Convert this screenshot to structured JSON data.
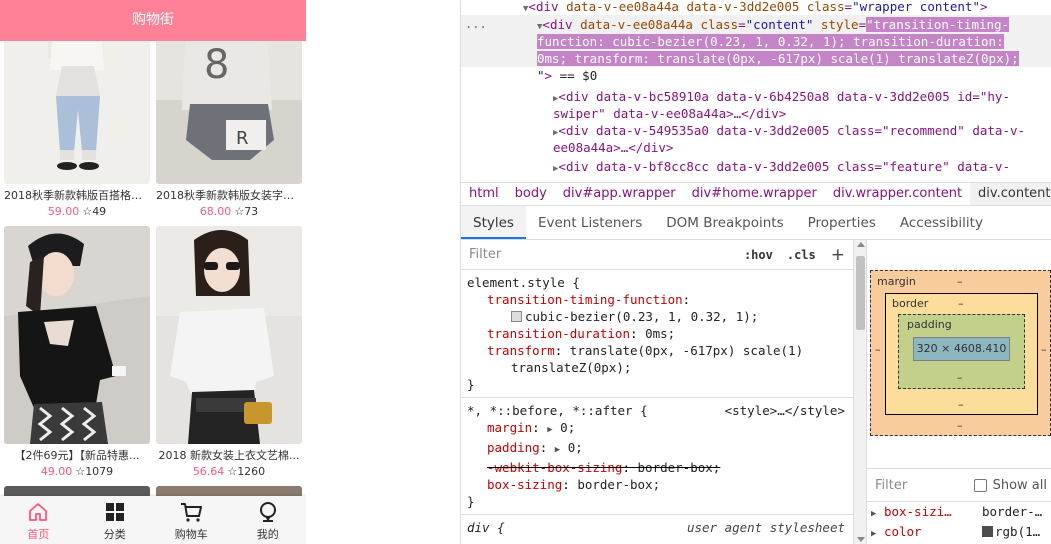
{
  "app": {
    "header_title": "购物街",
    "goods": [
      {
        "title": "2018秋季新款韩版百搭格子...",
        "price": "59.00",
        "fav": "49"
      },
      {
        "title": "2018秋季新款韩版女装字母...",
        "price": "68.00",
        "fav": "73"
      },
      {
        "title": "【2件69元】【新品特惠...",
        "price": "49.00",
        "fav": "1079"
      },
      {
        "title": "2018 新款女装上衣文艺棉...",
        "price": "56.64",
        "fav": "1260"
      }
    ],
    "tabs": [
      {
        "label": "首页",
        "icon": "home-icon",
        "active": true
      },
      {
        "label": "分类",
        "icon": "category-grid-icon",
        "active": false
      },
      {
        "label": "购物车",
        "icon": "cart-icon",
        "active": false
      },
      {
        "label": "我的",
        "icon": "profile-icon",
        "active": false
      }
    ],
    "colors": {
      "header": "#ff8198",
      "accent": "#ff5777"
    }
  },
  "devtools": {
    "dom": {
      "line1": {
        "tag": "div",
        "a1": "data-v-ee08a44a",
        "a2": "data-v-3dd2e005",
        "a3_name": "class",
        "a3_val": "\"wrapper content\""
      },
      "line2": {
        "tag": "div",
        "a1": "data-v-ee08a44a",
        "class_name": "class",
        "class_val": "\"content\"",
        "style_name": "style",
        "style_val_a": "\"transition-timing-",
        "style_val_b": "function: cubic-bezier(0.23, 1, 0.32, 1); transition-duration: ",
        "style_val_c": "0ms; transform: translate(0px, -617px) scale(1) translateZ(0px);",
        "style_val_d": "\"",
        "eq": " == $0",
        "dots": "..."
      },
      "line3": {
        "text_a": "div data-v-bc58910a data-v-6b4250a8 data-v-3dd2e005 id=\"hy-",
        "text_b": "swiper\" data-v-ee08a44a>…</div>"
      },
      "line4": {
        "text_a": "div data-v-549535a0 data-v-3dd2e005 class=\"recommend\" data-v-",
        "text_b": "ee08a44a>…</div>"
      },
      "line5": {
        "text_a": "div data-v-bf8cc8cc data-v-3dd2e005 class=\"feature\" data-v-"
      }
    },
    "breadcrumbs": [
      "html",
      "body",
      "div#app.wrapper",
      "div#home.wrapper",
      "div.wrapper.content",
      "div.content"
    ],
    "panel_tabs": [
      "Styles",
      "Event Listeners",
      "DOM Breakpoints",
      "Properties",
      "Accessibility"
    ],
    "styles": {
      "filter_placeholder": "Filter",
      "hov": ":hov",
      "cls": ".cls",
      "plus": "+",
      "element_style_selector": "element.style {",
      "es_props": [
        {
          "name": "transition-timing-function",
          "value": "cubic-bezier(0.23, 1, 0.32, 1);"
        },
        {
          "name": "transition-duration",
          "value": "0ms;"
        },
        {
          "name": "transform",
          "value_a": "translate(0px, -617px) scale(1)",
          "value_b": "translateZ(0px);"
        }
      ],
      "close_brace": "}",
      "universal_selector": "*, *::before, *::after {",
      "universal_source": "<style>…</style>",
      "u_props": [
        {
          "name": "margin",
          "value": "0;"
        },
        {
          "name": "padding",
          "value": "0;"
        },
        {
          "name": "-webkit-box-sizing",
          "value": "border-box;",
          "struck": true
        },
        {
          "name": "box-sizing",
          "value": "border-box;"
        }
      ],
      "div_selector": "div {",
      "div_source": "user agent stylesheet"
    },
    "box_model": {
      "margin_label": "margin",
      "border_label": "border",
      "padding_label": "padding",
      "dash": "–",
      "content_size": "320 × 4608.410",
      "colors": {
        "margin": "#f9cc9d",
        "border": "#fddd9b",
        "padding": "#c3d08b",
        "content": "#8cb6c0"
      }
    },
    "computed": {
      "filter_placeholder": "Filter",
      "show_all": "Show all",
      "rows": [
        {
          "name": "box-sizi…",
          "value": "border-…"
        },
        {
          "name": "color",
          "value": "rgb(1…"
        }
      ]
    }
  }
}
